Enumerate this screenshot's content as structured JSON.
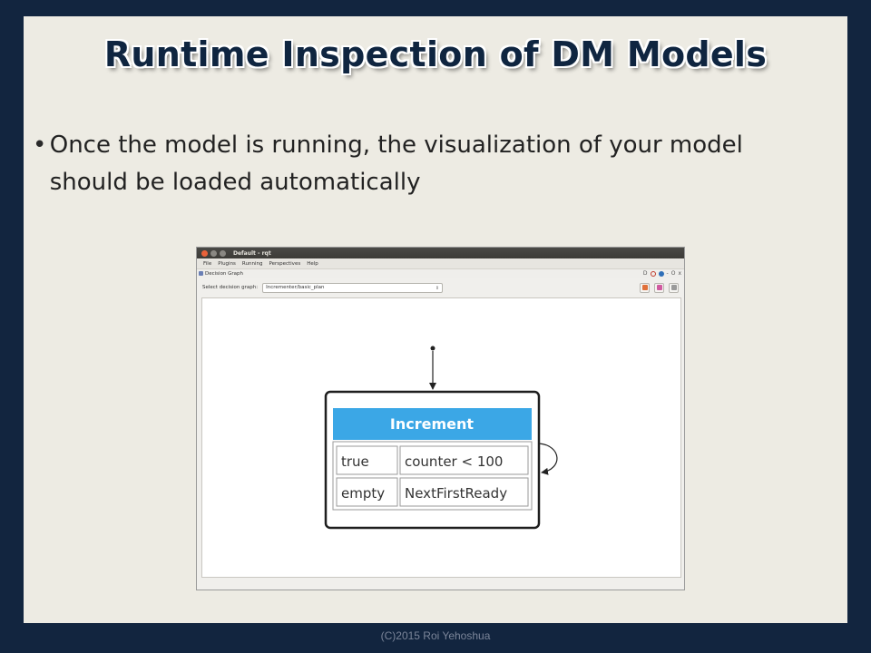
{
  "slide": {
    "title": "Runtime Inspection of DM Models",
    "bullet": "Once the model is running, the visualization of your model should be loaded automatically",
    "bullet_symbol": "•",
    "footer": "(C)2015 Roi Yehoshua"
  },
  "window": {
    "title": "Default - rqt",
    "menu": [
      "File",
      "Plugins",
      "Running",
      "Perspectives",
      "Help"
    ],
    "panel_title": "Decision Graph",
    "panel_controls": {
      "d_label": "D",
      "help_icon": "help-icon",
      "reload_icon": "reload-icon",
      "minimize": "-",
      "float": "O",
      "close": "x"
    },
    "select_label": "Select decision graph:",
    "select_value": "Incrementer/basic_plan",
    "toolbar_icons": [
      "open-folder-icon",
      "save-image-icon",
      "print-icon"
    ]
  },
  "graph": {
    "node_title": "Increment",
    "rows": [
      {
        "condition": "true",
        "action": "counter < 100"
      },
      {
        "condition": "empty",
        "action": "NextFirstReady"
      }
    ]
  },
  "colors": {
    "background": "#12253f",
    "slide": "#edebe3",
    "title": "#0f2540",
    "node_header": "#3ba7e6"
  }
}
